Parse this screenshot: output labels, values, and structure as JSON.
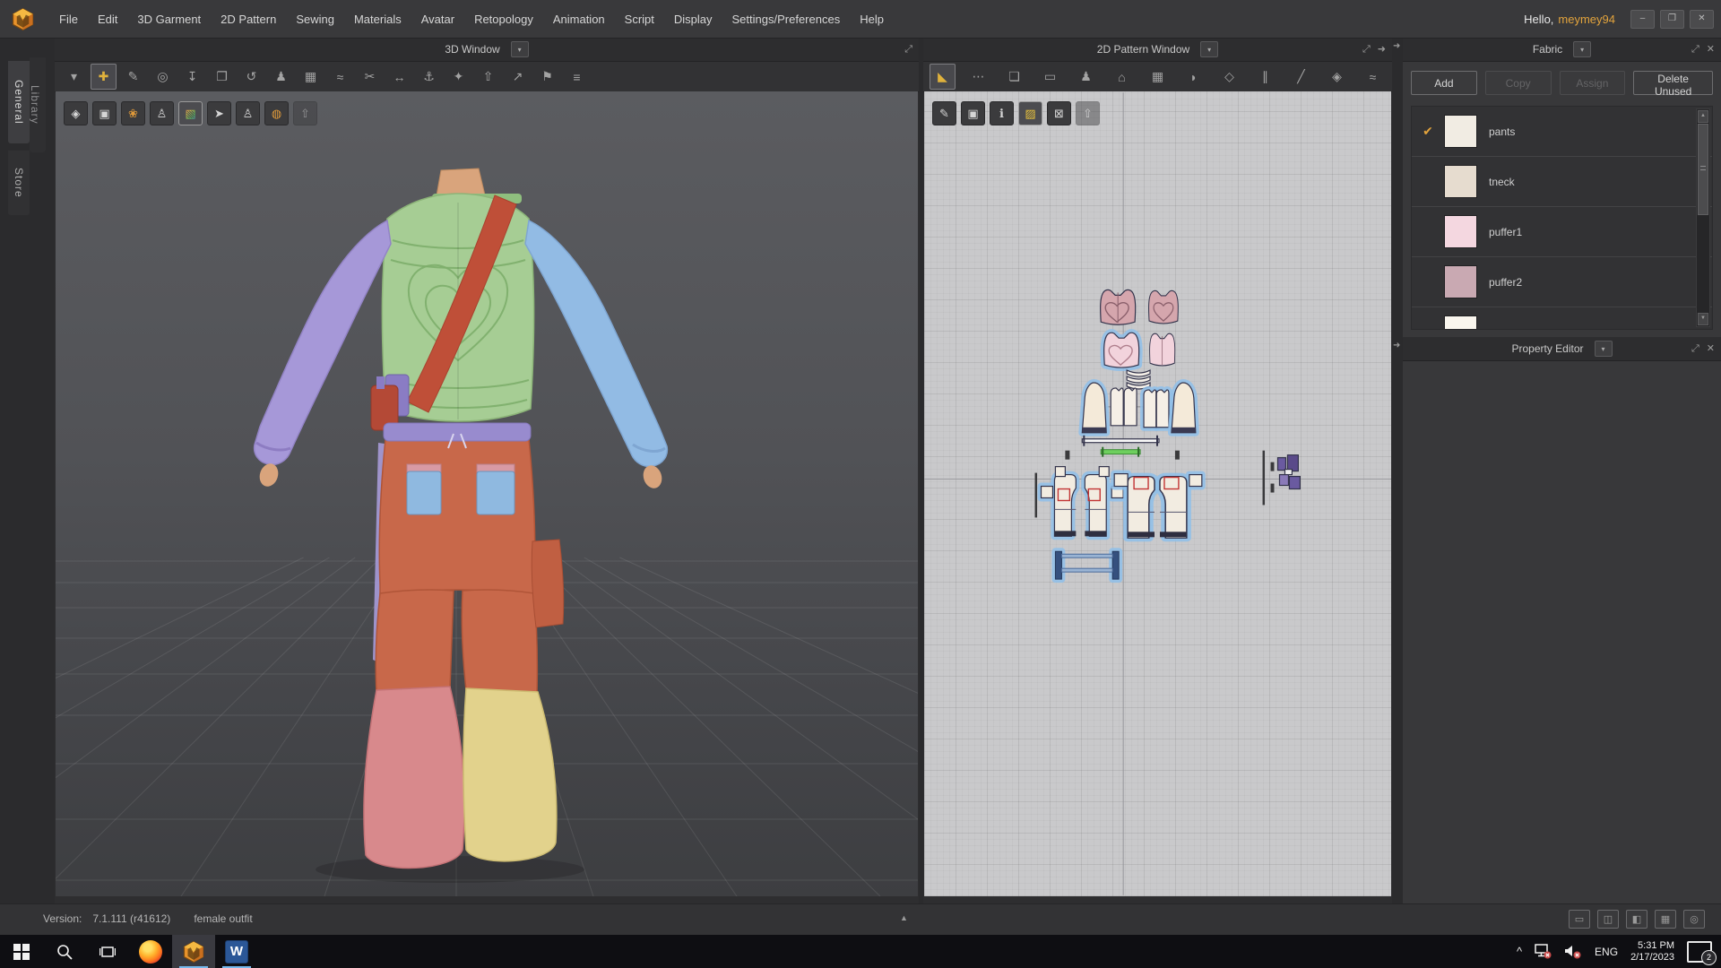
{
  "titlebar": {
    "greeting": "Hello,",
    "username": "meymey94",
    "window_buttons": [
      {
        "name": "minimize-button",
        "glyph": "–"
      },
      {
        "name": "restore-button",
        "glyph": "❐"
      },
      {
        "name": "close-button",
        "glyph": "✕"
      }
    ]
  },
  "menu": {
    "items": [
      "File",
      "Edit",
      "3D Garment",
      "2D Pattern",
      "Sewing",
      "Materials",
      "Avatar",
      "Retopology",
      "Animation",
      "Script",
      "Display",
      "Settings/Preferences",
      "Help"
    ]
  },
  "side_tabs": {
    "items": [
      {
        "label": "General",
        "active": true
      },
      {
        "label": "Library",
        "active": false
      },
      {
        "label": "Store",
        "active": false
      }
    ]
  },
  "glyphs": {
    "dropdown": "▾",
    "expand": "⤢",
    "close": "✕",
    "check": "✔",
    "collapse_up": "▲",
    "panel_arrow": "➜",
    "tray_chevron": "^",
    "word": "W"
  },
  "panel_3d": {
    "title": "3D Window",
    "toolbar_icons": [
      {
        "name": "simulate-icon",
        "glyph": "▾"
      },
      {
        "name": "select-move-icon",
        "glyph": "✚",
        "selected": true,
        "yellow": true
      },
      {
        "name": "select-pen-icon",
        "glyph": "✎"
      },
      {
        "name": "select-mesh-icon",
        "glyph": "◎"
      },
      {
        "name": "pin-icon",
        "glyph": "↧"
      },
      {
        "name": "move-pattern-icon",
        "glyph": "❐"
      },
      {
        "name": "fold-arrangement-icon",
        "glyph": "↺"
      },
      {
        "name": "arrangement-points-icon",
        "glyph": "♟"
      },
      {
        "name": "grid-arrangement-icon",
        "glyph": "▦"
      },
      {
        "name": "steam-brush-icon",
        "glyph": "≈"
      },
      {
        "name": "scissors-icon",
        "glyph": "✂"
      },
      {
        "name": "measure-icon",
        "glyph": "↔"
      },
      {
        "name": "tack-on-avatar-icon",
        "glyph": "⚓"
      },
      {
        "name": "pin-box-icon",
        "glyph": "✦"
      },
      {
        "name": "raise-hands-icon",
        "glyph": "⇧"
      },
      {
        "name": "scale-icon",
        "glyph": "↗"
      },
      {
        "name": "flatten-icon",
        "glyph": "⚑"
      },
      {
        "name": "stitch-view-icon",
        "glyph": "≡"
      }
    ],
    "overlay_icons": [
      {
        "name": "show-garment-dark-icon",
        "glyph": "◈"
      },
      {
        "name": "show-garment-thick-icon",
        "glyph": "▣"
      },
      {
        "name": "show-pressure-icon",
        "glyph": "❀",
        "orange": true
      },
      {
        "name": "show-avatar-icon",
        "glyph": "♙"
      },
      {
        "name": "show-colorways-icon",
        "glyph": "▧",
        "selected": true,
        "rainbow": true
      },
      {
        "name": "show-arrow-icon",
        "glyph": "➤"
      },
      {
        "name": "show-avatar-solid-icon",
        "glyph": "♙"
      },
      {
        "name": "show-avatar-mesh-icon",
        "glyph": "◍",
        "orange": true
      },
      {
        "name": "arrange-up-icon",
        "glyph": "⇧",
        "disabled": true
      }
    ]
  },
  "panel_2d": {
    "title": "2D Pattern Window",
    "toolbar_icons": [
      {
        "name": "transform-pattern-icon",
        "glyph": "◣",
        "selected": true,
        "yellow": true
      },
      {
        "name": "edit-pattern-icon",
        "glyph": "⋯"
      },
      {
        "name": "create-polygon-icon",
        "glyph": "❏"
      },
      {
        "name": "create-rectangle-icon",
        "glyph": "▭"
      },
      {
        "name": "avatar-overlay-icon",
        "glyph": "♟"
      },
      {
        "name": "sewing-machine-icon",
        "glyph": "⌂"
      },
      {
        "name": "grading-icon",
        "glyph": "▦"
      },
      {
        "name": "iron-icon",
        "glyph": "◗"
      },
      {
        "name": "trace-icon",
        "glyph": "◇"
      },
      {
        "name": "pleats-icon",
        "glyph": "∥"
      },
      {
        "name": "internal-line-icon",
        "glyph": "╱"
      },
      {
        "name": "darts-icon",
        "glyph": "◈"
      },
      {
        "name": "texture-edit-icon",
        "glyph": "≈"
      }
    ],
    "overlay_icons": [
      {
        "name": "show-stitch-icon",
        "glyph": "✎"
      },
      {
        "name": "show-pattern-shape-icon",
        "glyph": "▣"
      },
      {
        "name": "show-pattern-info-icon",
        "glyph": "ℹ"
      },
      {
        "name": "show-fabric-icon",
        "glyph": "▨",
        "selected": true,
        "yellow": true
      },
      {
        "name": "lock-pattern-icon",
        "glyph": "⊠"
      },
      {
        "name": "sync-arrangement-icon",
        "glyph": "⇧",
        "disabled": true
      }
    ]
  },
  "fabric_panel": {
    "title": "Fabric",
    "buttons": [
      {
        "label": "Add",
        "enabled": true
      },
      {
        "label": "Copy",
        "enabled": false
      },
      {
        "label": "Assign",
        "enabled": false
      },
      {
        "label": "Delete Unused",
        "enabled": true,
        "wide": true
      }
    ],
    "fabrics": [
      {
        "name": "pants",
        "swatch": "#f1ece3",
        "checked": true
      },
      {
        "name": "tneck",
        "swatch": "#e6dccf",
        "checked": false
      },
      {
        "name": "puffer1",
        "swatch": "#f4d7e0",
        "checked": false
      },
      {
        "name": "puffer2",
        "swatch": "#c9a9b2",
        "checked": false
      },
      {
        "name": "",
        "swatch": "#faf6ee",
        "checked": false
      }
    ]
  },
  "property_panel": {
    "title": "Property Editor"
  },
  "status_bar": {
    "version_label": "Version:",
    "version_value": "7.1.111 (r41612)",
    "project_name": "female outfit",
    "layout_icons": [
      {
        "name": "layout-single-icon",
        "glyph": "▭"
      },
      {
        "name": "layout-two-pane-icon",
        "glyph": "◫"
      },
      {
        "name": "layout-one-two-icon",
        "glyph": "◧"
      },
      {
        "name": "layout-quad-icon",
        "glyph": "▦"
      },
      {
        "name": "layout-render-icon",
        "glyph": "◎"
      }
    ]
  },
  "taskbar": {
    "language": "ENG",
    "time": "5:31 PM",
    "date": "2/17/2023",
    "notification_count": "2"
  },
  "colors": {
    "accent_orange": "#e2a33c",
    "selection_blue": "#8fc0ea",
    "vest_green": "#a6cd94",
    "sleeve_purple": "#a698d8",
    "sleeve_blue": "#92bbe4",
    "strap_red": "#bf4f38",
    "pants_orange": "#c8684a",
    "leg_pink": "#d8898c",
    "leg_yellow": "#e2d28c"
  }
}
